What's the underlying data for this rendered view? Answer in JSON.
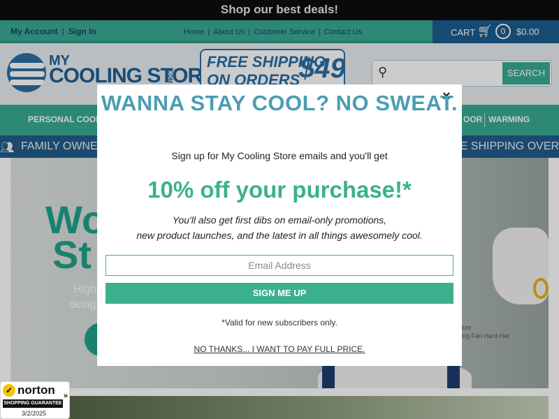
{
  "promo_bar": {
    "text": "Shop our best deals!"
  },
  "account": {
    "my_account": "My Account",
    "separator": "|",
    "sign_in": "Sign In"
  },
  "top_nav": {
    "items": [
      "Home",
      "About Us",
      "Customer Service",
      "Contact Us"
    ],
    "separator": "|"
  },
  "cart": {
    "label": "CART",
    "count": "0",
    "total": "$0.00"
  },
  "logo": {
    "line1": "MY",
    "line2": "COOLING STORE",
    "suffix": ".COM"
  },
  "shipping_badge": {
    "line1": "FREE SHIPPING",
    "line2": "ON ORDERS OVER",
    "amount": "$49"
  },
  "search": {
    "placeholder": "",
    "button_label": "SEARCH"
  },
  "main_nav": {
    "items": [
      "PERSONAL COOLING",
      "OOR",
      "WARMING"
    ]
  },
  "family_band": {
    "left_text": "FAMILY OWNED",
    "right_text": "EE SHIPPING OVER $"
  },
  "hero": {
    "title_line1": "Wo",
    "title_line2": "St",
    "sub_line1": "High",
    "sub_line2": "desig",
    "caption_line1": "eeze",
    "caption_line2": "oling Fan Hard Hat"
  },
  "norton": {
    "brand": "norton",
    "guarantee": "SHOPPING GUARANTEE",
    "date": "3/2/2025"
  },
  "modal": {
    "close_label": "×",
    "headline": "WANNA STAY COOL? NO SWEAT.",
    "intro": "Sign up for My Cooling Store emails and you'll get",
    "offer": "10% off your purchase!*",
    "perk_line1": "You'll also get first dibs on email-only promotions,",
    "perk_line2": "new product launches, and the latest in all things awesomely cool.",
    "email_placeholder": "Email Address",
    "signup_label": "SIGN ME UP",
    "valid_note": "*Valid for new subscribers only.",
    "no_thanks": "NO THANKS... I WANT TO PAY FULL PRICE."
  },
  "colors": {
    "teal": "#3aab94",
    "navy": "#1b5d8f",
    "headline_blue": "#4c9db2",
    "offer_green": "#3bb08f"
  }
}
